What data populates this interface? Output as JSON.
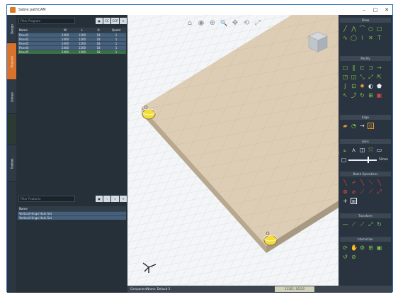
{
  "window": {
    "title": "Sabre pathCAM",
    "controls": [
      "–",
      "□",
      "✕"
    ]
  },
  "vertical_tabs": [
    {
      "label": "Design",
      "active": false
    },
    {
      "label": "Program",
      "active": true
    },
    {
      "label": "Library",
      "active": false
    },
    {
      "label": "",
      "active": false
    },
    {
      "label": "Toolbox",
      "active": false
    }
  ],
  "programs_panel": {
    "search_placeholder": "Filter Program",
    "buttons": [
      "▣",
      "CC",
      "CCP",
      "✕"
    ],
    "columns": [
      "Name",
      "W",
      "L",
      "D",
      "Quant"
    ],
    "rows": [
      [
        "Panel1",
        "2400",
        "1200",
        "18",
        "1"
      ],
      [
        "Panel2",
        "2400",
        "1200",
        "18",
        "1"
      ],
      [
        "Panel3",
        "2400",
        "1200",
        "18",
        "1"
      ],
      [
        "Panel4",
        "2400",
        "1200",
        "18",
        "1"
      ],
      [
        "Panel5",
        "2400",
        "1200",
        "18",
        "1"
      ]
    ],
    "selected_row": 4
  },
  "features_panel": {
    "search_placeholder": "Filter Features",
    "buttons": [
      "▣",
      "‹",
      "‹‹",
      "+"
    ],
    "column": "Name",
    "rows": [
      "Vertical Hinge Hole Set",
      "Vertical Hinge Hole Set"
    ]
  },
  "viewport": {
    "nav_icons": [
      "home-icon",
      "orbit-icon",
      "zoom-window-icon",
      "zoom-icon",
      "pan-icon",
      "rotate-icon",
      "fit-icon"
    ],
    "nav_glyphs": [
      "⌂",
      "◉",
      "⊕",
      "🔍",
      "✥",
      "⟲",
      "⤢"
    ]
  },
  "status": {
    "text": "ComponentName: Default 3",
    "coords": "12365, 16530"
  },
  "toolbox": {
    "sections": [
      "Draw",
      "Modify",
      "Edge",
      "Joins",
      "Batch Operations",
      "Transform",
      "Interaction"
    ],
    "slider_value": 70,
    "slider_label": "50mm"
  },
  "colors": {
    "panel_dark": "#263039",
    "accent_orange": "#d9722a",
    "tool_green": "#7fc44a",
    "board": "#d9c9b1",
    "selection_row": "#3b6e4a"
  }
}
